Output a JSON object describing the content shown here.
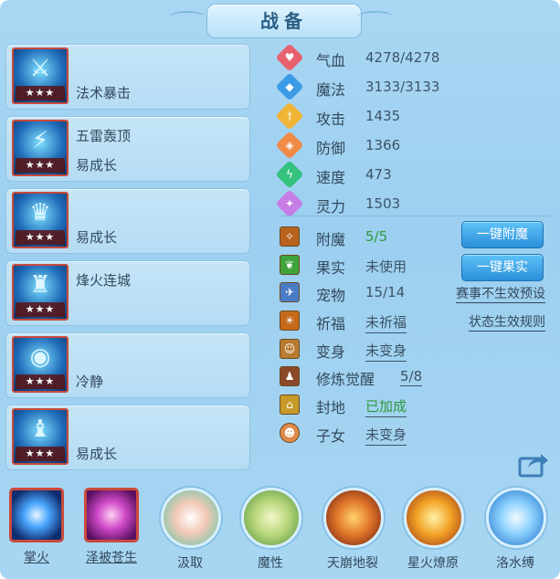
{
  "title": "战备",
  "skills": [
    {
      "names": [
        "法术暴击"
      ],
      "stars": "★★★"
    },
    {
      "names": [
        "五雷轰顶",
        "易成长"
      ],
      "stars": "★★★"
    },
    {
      "names": [
        "易成长"
      ],
      "stars": "★★★"
    },
    {
      "names": [
        "烽火连城"
      ],
      "stars": "★★★"
    },
    {
      "names": [
        "冷静"
      ],
      "stars": "★★★"
    },
    {
      "names": [
        "易成长"
      ],
      "stars": "★★★"
    }
  ],
  "stats": [
    {
      "label": "气血",
      "value": "4278/4278",
      "color": "#e8616e",
      "icon": "heart-icon"
    },
    {
      "label": "魔法",
      "value": "3133/3133",
      "color": "#3c9be6",
      "icon": "mana-icon"
    },
    {
      "label": "攻击",
      "value": "1435",
      "color": "#f0b437",
      "icon": "sword-icon"
    },
    {
      "label": "防御",
      "value": "1366",
      "color": "#f08a45",
      "icon": "shield-icon"
    },
    {
      "label": "速度",
      "value": "473",
      "color": "#34c27e",
      "icon": "speed-icon"
    },
    {
      "label": "灵力",
      "value": "1503",
      "color": "#c77de6",
      "icon": "spirit-icon"
    }
  ],
  "rows": {
    "enchant": {
      "label": "附魔",
      "value": "5/5",
      "button": "一键附魔"
    },
    "fruit": {
      "label": "果实",
      "value": "未使用",
      "button": "一键果实"
    },
    "pet": {
      "label": "宠物",
      "value": "15/14",
      "link": "赛事不生效预设"
    },
    "bless": {
      "label": "祈福",
      "value": "未祈福",
      "link": "状态生效规则"
    },
    "transform": {
      "label": "变身",
      "value": "未变身"
    },
    "awaken": {
      "label": "修炼觉醒",
      "value": "5/8"
    },
    "fief": {
      "label": "封地",
      "value": "已加成"
    },
    "child": {
      "label": "子女",
      "value": "未变身"
    }
  },
  "bottom": [
    {
      "label": "掌火",
      "icon": "palm-fire-icon"
    },
    {
      "label": "泽被苍生",
      "icon": "blessing-icon"
    },
    {
      "label": "汲取",
      "icon": "absorb-icon"
    },
    {
      "label": "魔性",
      "icon": "demon-icon"
    },
    {
      "label": "天崩地裂",
      "icon": "earthquake-icon"
    },
    {
      "label": "星火燎原",
      "icon": "wildfire-icon"
    },
    {
      "label": "洛水缚",
      "icon": "water-bind-icon"
    }
  ]
}
